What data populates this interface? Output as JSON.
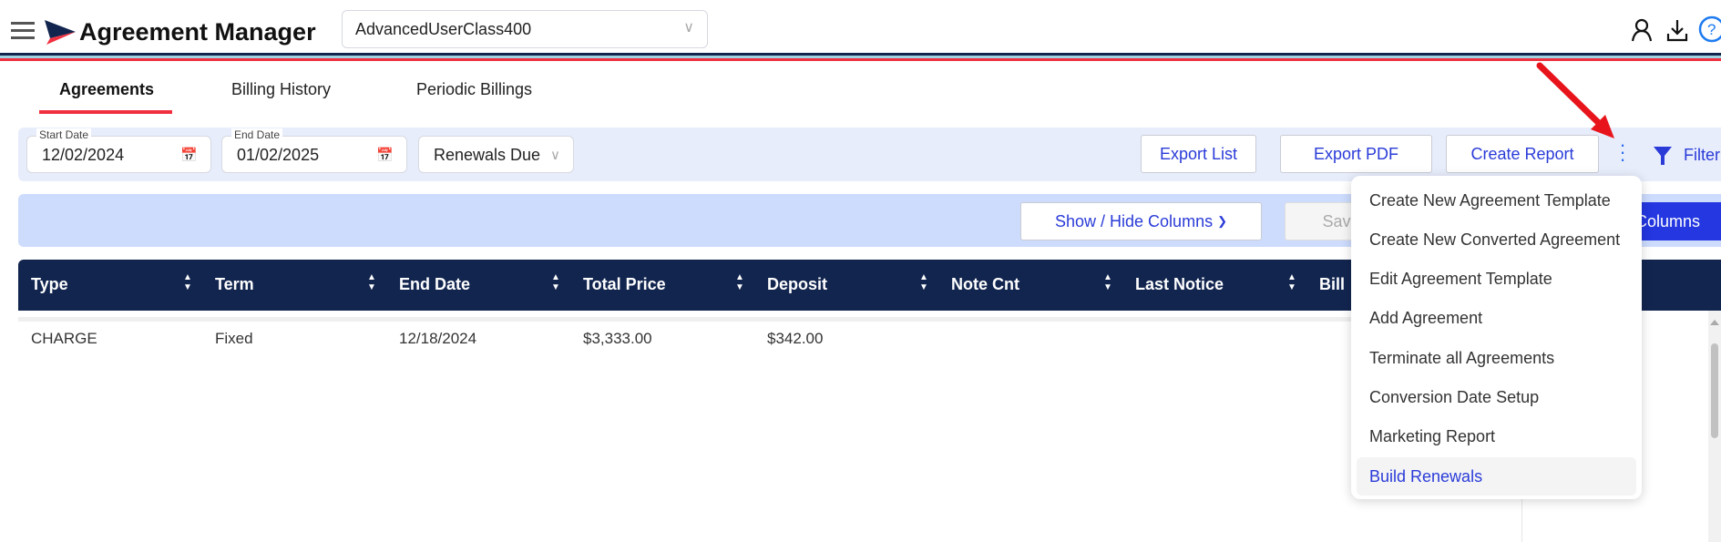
{
  "header": {
    "title": "Agreement Manager",
    "class_select": "AdvancedUserClass400",
    "icons": [
      "menu-icon",
      "logo",
      "user-icon",
      "download-icon",
      "help-icon"
    ]
  },
  "tabs": [
    {
      "label": "Agreements",
      "active": true
    },
    {
      "label": "Billing History"
    },
    {
      "label": "Periodic Billings"
    }
  ],
  "filters": {
    "start_date_label": "Start Date",
    "start_date": "12/02/2024",
    "end_date_label": "End Date",
    "end_date": "01/02/2025",
    "status": "Renewals Due"
  },
  "toolbar": {
    "export_list": "Export List",
    "export_pdf": "Export PDF",
    "create_report": "Create Report",
    "filter": "Filter"
  },
  "columns_bar": {
    "show_hide": "Show / Hide Columns",
    "save": "Save Columns",
    "blue_button": "Columns"
  },
  "table": {
    "headers": [
      "Type",
      "Term",
      "End Date",
      "Total Price",
      "Deposit",
      "Note Cnt",
      "Last Notice",
      "Bill"
    ],
    "rows": [
      [
        "CHARGE",
        "Fixed",
        "12/18/2024",
        "$3,333.00",
        "$342.00"
      ]
    ]
  },
  "menu": {
    "items": [
      "Create New Agreement Template",
      "Create New Converted Agreement",
      "Edit Agreement Template",
      "Add Agreement",
      "Terminate all Agreements",
      "Conversion Date Setup",
      "Marketing Report",
      "Build Renewals"
    ],
    "highlighted": "Build Renewals"
  },
  "colors": {
    "navy": "#12254f",
    "accent_red": "#f0303f",
    "link_blue": "#2a3bd8",
    "band": "#e8edfc",
    "band2": "#cddbfd"
  }
}
